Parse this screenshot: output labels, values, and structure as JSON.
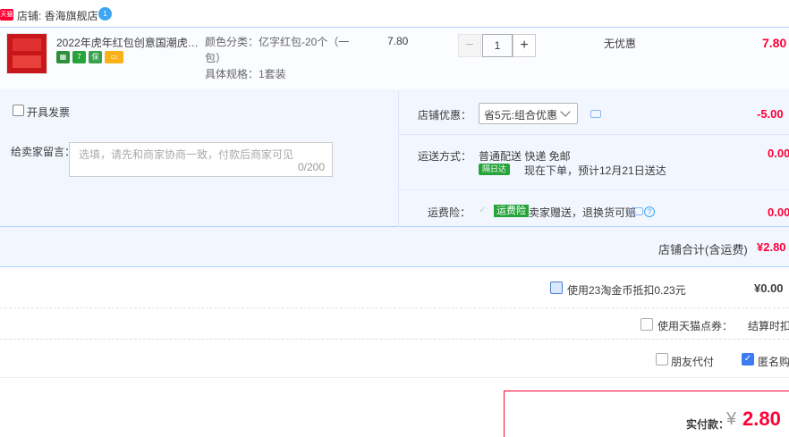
{
  "shop": {
    "badge": "天猫",
    "name": "店铺: 香海旗舰店",
    "chat_badge": "1"
  },
  "item": {
    "title": "2022年虎年红包创意国潮虎虎...",
    "service_icons": [
      {
        "name": "tmall-7day-icon",
        "text": "",
        "color": "#2f8f3c"
      },
      {
        "name": "seven-day-return-icon",
        "text": "7",
        "color": "#27a33a"
      },
      {
        "name": "guarantee-icon",
        "text": "保",
        "color": "#39a04e"
      },
      {
        "name": "card-pay-icon",
        "text": "",
        "color": "#f7b319"
      }
    ],
    "attr_color": "颜色分类：亿字红包-20个（一",
    "attr_color_cont": "包）",
    "attr_spec": "具体规格：1套装",
    "price": "7.80",
    "qty_minus": "−",
    "quantity": "1",
    "qty_plus": "+",
    "promo": "无优惠",
    "subtotal": "7.80"
  },
  "options": {
    "invoice_label": "开具发票",
    "message_label": "给卖家留言：",
    "message_placeholder": "选填，请先和商家协商一致，付款后商家可见",
    "message_count": "0/200",
    "shop_discount_label": "店铺优惠：",
    "shop_discount_value": "省5元:组合优惠",
    "shop_discount_amount": "-5.00",
    "shipping_label": "运送方式：",
    "shipping_method": "普通配送 快递 免邮",
    "shipping_tag": "隔日达",
    "shipping_eta": "现在下单，预计12月21日送达",
    "shipping_amount": "0.00",
    "insurance_label": "运费险：",
    "insurance_tag": "运费险",
    "insurance_desc": "卖家赠送，退换货可赔",
    "insurance_amount": "0.00"
  },
  "shop_total": {
    "label": "店铺合计(含运费)",
    "amount": "¥2.80"
  },
  "coins": {
    "label": "使用23淘金币抵扣0.23元",
    "amount": "¥0.00"
  },
  "coupon": {
    "label": "使用天猫点券：",
    "note": "结算时扣"
  },
  "flags": {
    "friend_pay": "朋友代付",
    "anonymous": "匿名购买"
  },
  "payment": {
    "label": "实付款：",
    "currency": "¥",
    "amount": "2.80"
  }
}
